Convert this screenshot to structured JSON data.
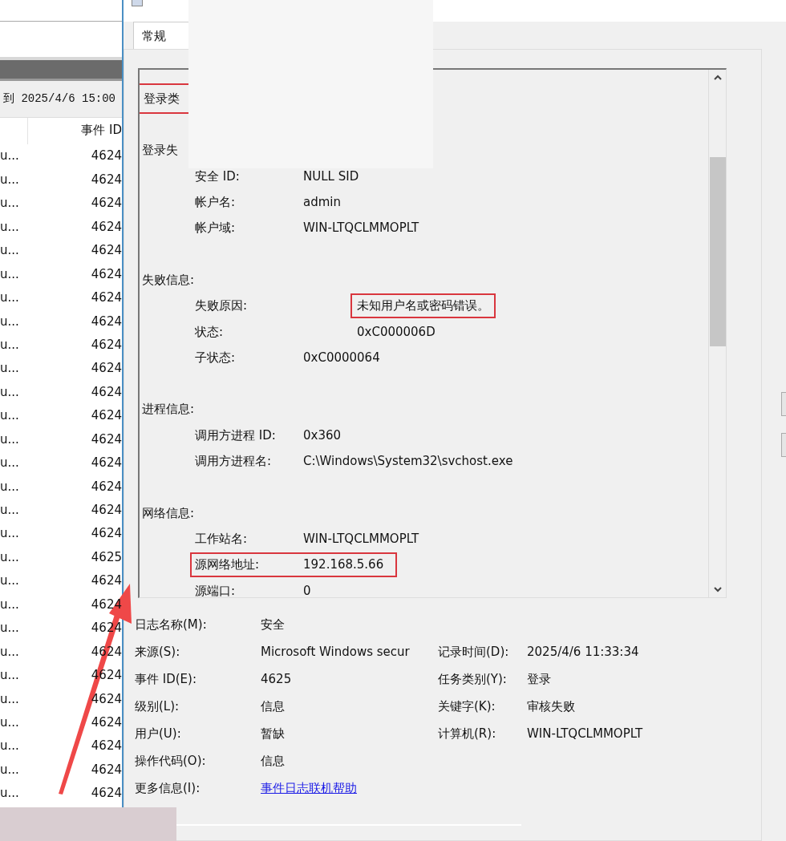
{
  "event_list": {
    "range_label": "到 2025/4/6 15:00",
    "column_header": "事件 ID",
    "rows": [
      {
        "source": "u...",
        "event_id": "4624"
      },
      {
        "source": "u...",
        "event_id": "4624"
      },
      {
        "source": "u...",
        "event_id": "4624"
      },
      {
        "source": "u...",
        "event_id": "4624"
      },
      {
        "source": "u...",
        "event_id": "4624"
      },
      {
        "source": "u...",
        "event_id": "4624"
      },
      {
        "source": "u...",
        "event_id": "4624"
      },
      {
        "source": "u...",
        "event_id": "4624"
      },
      {
        "source": "u...",
        "event_id": "4624"
      },
      {
        "source": "u...",
        "event_id": "4624"
      },
      {
        "source": "u...",
        "event_id": "4624"
      },
      {
        "source": "u...",
        "event_id": "4624"
      },
      {
        "source": "u...",
        "event_id": "4624"
      },
      {
        "source": "u...",
        "event_id": "4624"
      },
      {
        "source": "u...",
        "event_id": "4624"
      },
      {
        "source": "u...",
        "event_id": "4624"
      },
      {
        "source": "u...",
        "event_id": "4624"
      },
      {
        "source": "u...",
        "event_id": "4625"
      },
      {
        "source": "u...",
        "event_id": "4624"
      },
      {
        "source": "u...",
        "event_id": "4624"
      },
      {
        "source": "u...",
        "event_id": "4624"
      },
      {
        "source": "u...",
        "event_id": "4624"
      },
      {
        "source": "u...",
        "event_id": "4624"
      },
      {
        "source": "u...",
        "event_id": "4624"
      },
      {
        "source": "u...",
        "event_id": "4624"
      },
      {
        "source": "u...",
        "event_id": "4624"
      },
      {
        "source": "u...",
        "event_id": "4624"
      },
      {
        "source": "u...",
        "event_id": "4624"
      }
    ]
  },
  "dialog": {
    "tabs": [
      {
        "label": "常规",
        "selected": true
      }
    ],
    "details": [
      {
        "heading": "登录类",
        "highlighted": true
      },
      {
        "heading": "登录失",
        "fields": [
          {
            "label": "安全 ID:",
            "value": "NULL SID"
          },
          {
            "label": "帐户名:",
            "value": "admin"
          },
          {
            "label": "帐户域:",
            "value": "WIN-LTQCLMMOPLT"
          }
        ]
      },
      {
        "heading": "失败信息:",
        "fields": [
          {
            "label": "失败原因:",
            "value": "未知用户名或密码错误。",
            "kind": "far",
            "highlighted": true
          },
          {
            "label": "状态:",
            "value": "0xC000006D",
            "kind": "far"
          },
          {
            "label": "子状态:",
            "value": "0xC0000064"
          }
        ]
      },
      {
        "heading": "进程信息:",
        "fields": [
          {
            "label": "调用方进程 ID:",
            "value": "0x360"
          },
          {
            "label": "调用方进程名:",
            "value": "C:\\Windows\\System32\\svchost.exe"
          }
        ]
      },
      {
        "heading": "网络信息:",
        "fields": [
          {
            "label": "工作站名:",
            "value": "WIN-LTQCLMMOPLT"
          },
          {
            "label": "源网络地址:",
            "value": "192.168.5.66",
            "highlighted": true,
            "kind": "row"
          },
          {
            "label": "源端口:",
            "value": "0"
          }
        ]
      }
    ],
    "properties": [
      {
        "label": "日志名称(M):",
        "value": "安全"
      },
      {
        "label": "来源(S):",
        "value": "Microsoft Windows secur",
        "label2": "记录时间(D):",
        "value2": "2025/4/6 11:33:34"
      },
      {
        "label": "事件 ID(E):",
        "value": "4625",
        "label2": "任务类别(Y):",
        "value2": "登录"
      },
      {
        "label": "级别(L):",
        "value": "信息",
        "label2": "关键字(K):",
        "value2": "审核失败"
      },
      {
        "label": "用户(U):",
        "value": "暂缺",
        "label2": "计算机(R):",
        "value2": "WIN-LTQCLMMOPLT"
      },
      {
        "label": "操作代码(O):",
        "value": "信息"
      },
      {
        "label": "更多信息(I):",
        "value": "事件日志联机帮助",
        "kind": "link"
      }
    ]
  }
}
